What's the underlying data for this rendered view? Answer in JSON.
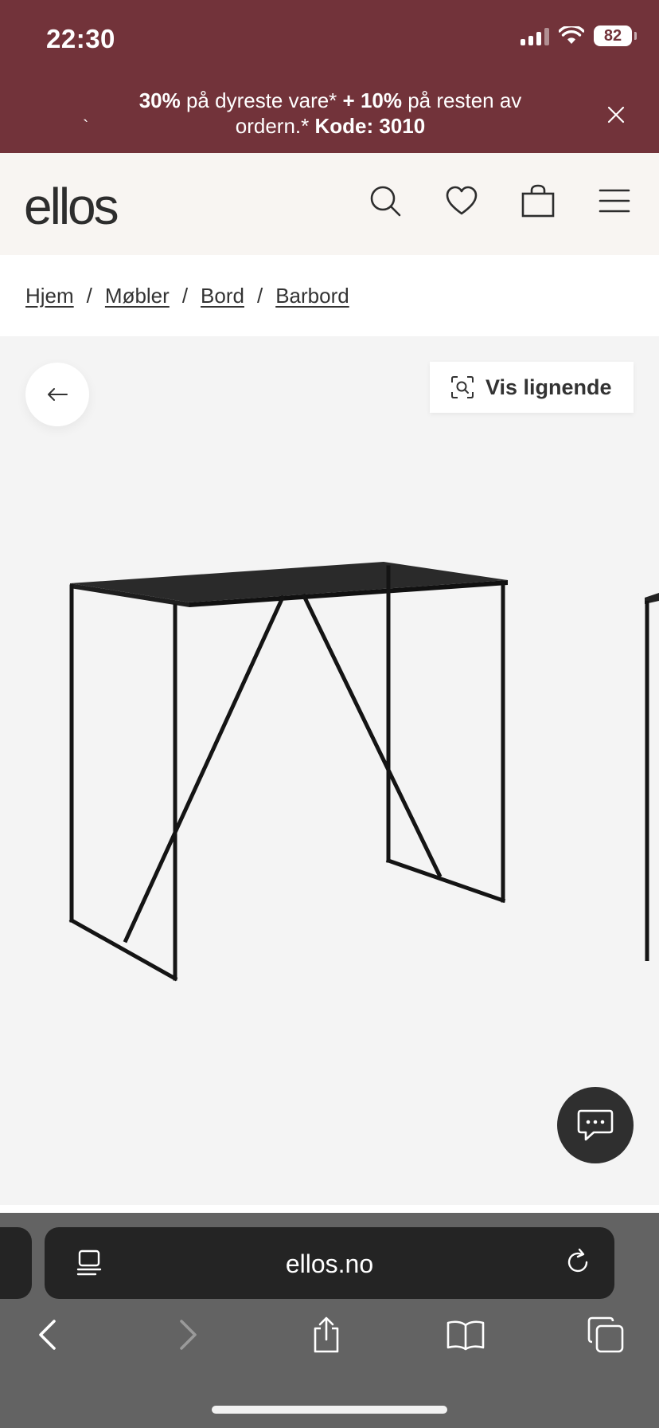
{
  "status_bar": {
    "time": "22:30",
    "battery": "82"
  },
  "promo": {
    "bold1": "30%",
    "text1": " på dyreste vare* ",
    "bold2": "+ 10%",
    "text2": " på resten av ordern.* ",
    "bold3": "Kode: 3010",
    "tick": "`"
  },
  "header": {
    "logo": "ellos"
  },
  "breadcrumb": [
    "Hjem",
    "Møbler",
    "Bord",
    "Barbord"
  ],
  "gallery": {
    "similar_label": "Vis lignende"
  },
  "browser": {
    "url": "ellos.no"
  },
  "colors": {
    "promo_bg": "#72333a",
    "header_bg": "#f8f5f2",
    "gallery_bg": "#f4f4f4",
    "browser_bg": "#636363"
  }
}
